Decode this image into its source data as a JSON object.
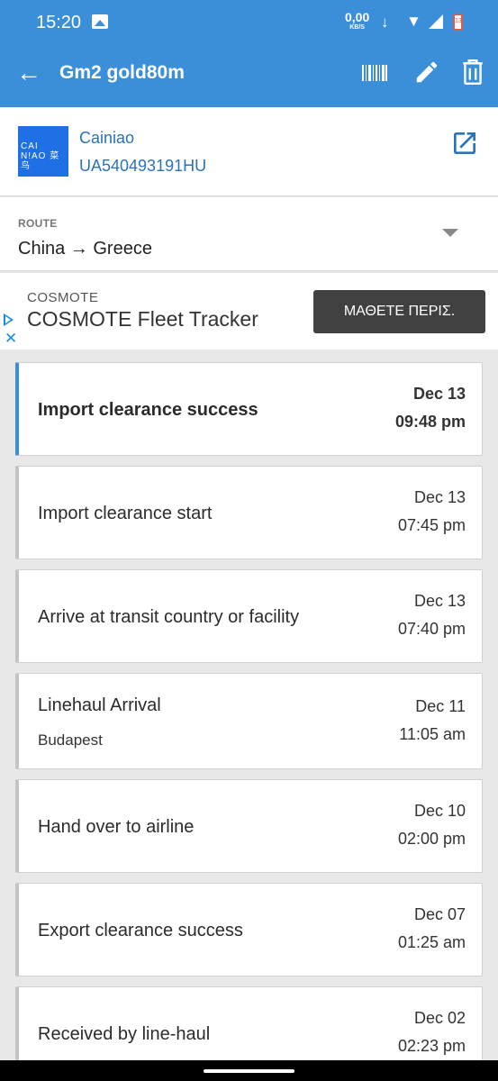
{
  "status_bar": {
    "time": "15:20",
    "speed_value": "0,00",
    "speed_unit": "KB/S",
    "battery_level": "13"
  },
  "app_bar": {
    "title": "Gm2 gold80m"
  },
  "carrier": {
    "logo_text_line1": "CAI",
    "logo_text_line2": "N!AO 菜鸟",
    "name": "Cainiao",
    "tracking_number": "UA540493191HU"
  },
  "route": {
    "label": "ROUTE",
    "value": "China → Greece"
  },
  "ad": {
    "advertiser": "COSMOTE",
    "headline": "COSMOTE Fleet Tracker",
    "cta": "ΜΑΘΕΤΕ ΠΕΡΙΣ."
  },
  "events": [
    {
      "title": "Import clearance success",
      "location": "",
      "date": "Dec 13",
      "time": "09:48 pm",
      "active": true
    },
    {
      "title": "Import clearance start",
      "location": "",
      "date": "Dec 13",
      "time": "07:45 pm",
      "active": false
    },
    {
      "title": "Arrive at transit country or facility",
      "location": "",
      "date": "Dec 13",
      "time": "07:40 pm",
      "active": false
    },
    {
      "title": "Linehaul Arrival",
      "location": "Budapest",
      "date": "Dec 11",
      "time": "11:05 am",
      "active": false
    },
    {
      "title": "Hand over to airline",
      "location": "",
      "date": "Dec 10",
      "time": "02:00 pm",
      "active": false
    },
    {
      "title": "Export clearance success",
      "location": "",
      "date": "Dec 07",
      "time": "01:25 am",
      "active": false
    },
    {
      "title": "Received by line-haul",
      "location": "",
      "date": "Dec 02",
      "time": "02:23 pm",
      "active": false
    }
  ],
  "colors": {
    "primary": "#3b8fd9",
    "link": "#2a73b8",
    "logo_bg": "#1f6fe5",
    "ad_accent": "#1a8bd8"
  }
}
